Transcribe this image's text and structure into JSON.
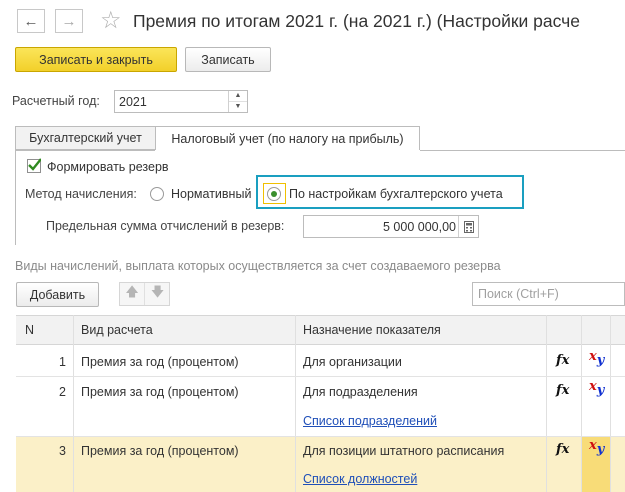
{
  "window": {
    "title": "Премия по итогам 2021 г. (на 2021 г.) (Настройки расче",
    "back_glyph": "←",
    "forward_glyph": "→",
    "star_glyph": "☆"
  },
  "toolbar": {
    "save_close_label": "Записать и закрыть",
    "save_label": "Записать"
  },
  "calc_year": {
    "label": "Расчетный год:",
    "value": "2021"
  },
  "tabs": [
    {
      "label": "Бухгалтерский учет",
      "active": false
    },
    {
      "label": "Налоговый учет (по налогу на прибыль)",
      "active": true
    }
  ],
  "reserve": {
    "checkbox_label": "Формировать резерв",
    "checked": true,
    "method_label": "Метод начисления:",
    "option_normative": "Нормативный",
    "option_accounting": "По настройкам бухгалтерского учета",
    "selected_option": "accounting",
    "limit_label": "Предельная сумма отчислений в резерв:",
    "limit_value": "5 000 000,00"
  },
  "list": {
    "caption": "Виды начислений, выплата которых осуществляется за счет создаваемого резерва",
    "add_label": "Добавить",
    "search_placeholder": "Поиск (Ctrl+F)"
  },
  "table": {
    "columns": [
      "N",
      "Вид расчета",
      "Назначение показателя"
    ],
    "rows": [
      {
        "n": "1",
        "kind": "Премия за год (процентом)",
        "purpose": "Для организации",
        "link": "",
        "fx": "fx",
        "xy": "xy"
      },
      {
        "n": "2",
        "kind": "Премия за год (процентом)",
        "purpose": "Для подразделения",
        "link": "Список подразделений",
        "fx": "fx",
        "xy": "xy"
      },
      {
        "n": "3",
        "kind": "Премия за год (процентом)",
        "purpose": "Для позиции штатного расписания",
        "link": "Список должностей",
        "fx": "fx",
        "xy": "xy",
        "selected": true
      }
    ]
  },
  "colors": {
    "accent": "#f2d02a",
    "highlight_border": "#1a9fc0",
    "selected_row": "#fbf0c8",
    "link": "#1f4fb8"
  }
}
